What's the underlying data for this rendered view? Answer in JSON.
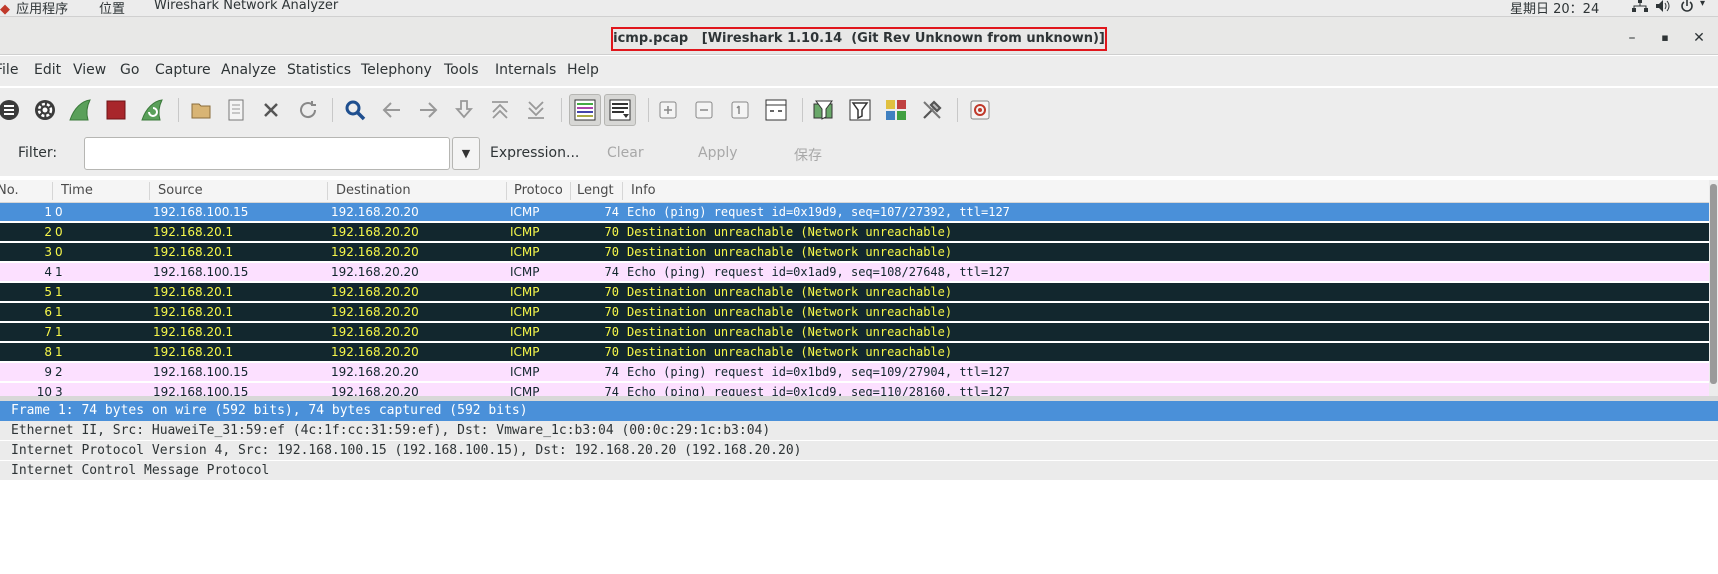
{
  "system_bar": {
    "apps_label": "应用程序",
    "places_label": "位置",
    "app_label": "Wireshark Network Analyzer",
    "clock": "星期日 20：24"
  },
  "window": {
    "title": "icmp.pcap   [Wireshark 1.10.14  (Git Rev Unknown from unknown)]"
  },
  "menu": [
    "File",
    "Edit",
    "View",
    "Go",
    "Capture",
    "Analyze",
    "Statistics",
    "Telephony",
    "Tools",
    "Internals",
    "Help"
  ],
  "toolbar_icons": [
    "interfaces-icon",
    "options-icon",
    "start-capture-icon",
    "stop-capture-icon",
    "restart-capture-icon",
    "open-file-icon",
    "save-file-icon",
    "close-file-icon",
    "reload-icon",
    "find-packet-icon",
    "go-back-icon",
    "go-forward-icon",
    "go-to-packet-icon",
    "go-first-icon",
    "go-last-icon",
    "colorize-icon",
    "auto-scroll-icon",
    "zoom-in-icon",
    "zoom-out-icon",
    "normal-size-icon",
    "resize-columns-icon",
    "capture-filters-icon",
    "display-filters-icon",
    "coloring-rules-icon",
    "preferences-icon",
    "help-icon"
  ],
  "filter": {
    "label": "Filter:",
    "value": "",
    "expression": "Expression...",
    "clear": "Clear",
    "apply": "Apply",
    "save": "保存"
  },
  "packet_list": {
    "columns": [
      "No.",
      "Time",
      "Source",
      "Destination",
      "Protocol",
      "Length",
      "Info"
    ],
    "column_display": [
      "No.",
      "Time",
      "Source",
      "Destination",
      "Protoco",
      "Lengt",
      "Info"
    ],
    "rows": [
      {
        "no": "1",
        "time": "0",
        "src": "192.168.100.15",
        "dst": "192.168.20.20",
        "proto": "ICMP",
        "len": "74",
        "info": "Echo (ping) request  id=0x19d9, seq=107/27392, ttl=127",
        "style": "sel"
      },
      {
        "no": "2",
        "time": "0",
        "src": "192.168.20.1",
        "dst": "192.168.20.20",
        "proto": "ICMP",
        "len": "70",
        "info": "Destination unreachable (Network unreachable)",
        "style": "dark"
      },
      {
        "no": "3",
        "time": "0",
        "src": "192.168.20.1",
        "dst": "192.168.20.20",
        "proto": "ICMP",
        "len": "70",
        "info": "Destination unreachable (Network unreachable)",
        "style": "dark"
      },
      {
        "no": "4",
        "time": "1",
        "src": "192.168.100.15",
        "dst": "192.168.20.20",
        "proto": "ICMP",
        "len": "74",
        "info": "Echo (ping) request  id=0x1ad9, seq=108/27648, ttl=127",
        "style": "pink"
      },
      {
        "no": "5",
        "time": "1",
        "src": "192.168.20.1",
        "dst": "192.168.20.20",
        "proto": "ICMP",
        "len": "70",
        "info": "Destination unreachable (Network unreachable)",
        "style": "dark"
      },
      {
        "no": "6",
        "time": "1",
        "src": "192.168.20.1",
        "dst": "192.168.20.20",
        "proto": "ICMP",
        "len": "70",
        "info": "Destination unreachable (Network unreachable)",
        "style": "dark"
      },
      {
        "no": "7",
        "time": "1",
        "src": "192.168.20.1",
        "dst": "192.168.20.20",
        "proto": "ICMP",
        "len": "70",
        "info": "Destination unreachable (Network unreachable)",
        "style": "dark"
      },
      {
        "no": "8",
        "time": "1",
        "src": "192.168.20.1",
        "dst": "192.168.20.20",
        "proto": "ICMP",
        "len": "70",
        "info": "Destination unreachable (Network unreachable)",
        "style": "dark"
      },
      {
        "no": "9",
        "time": "2",
        "src": "192.168.100.15",
        "dst": "192.168.20.20",
        "proto": "ICMP",
        "len": "74",
        "info": "Echo (ping) request  id=0x1bd9, seq=109/27904, ttl=127",
        "style": "pink"
      },
      {
        "no": "10",
        "time": "3",
        "src": "192.168.100.15",
        "dst": "192.168.20.20",
        "proto": "ICMP",
        "len": "74",
        "info": "Echo (ping) request  id=0x1cd9, seq=110/28160, ttl=127",
        "style": "pink"
      }
    ]
  },
  "details": [
    {
      "text": "Frame 1: 74 bytes on wire (592 bits), 74 bytes captured (592 bits)",
      "style": "sel"
    },
    {
      "text": "Ethernet II, Src: HuaweiTe_31:59:ef (4c:1f:cc:31:59:ef), Dst: Vmware_1c:b3:04 (00:0c:29:1c:b3:04)",
      "style": "grey"
    },
    {
      "text": "Internet Protocol Version 4, Src: 192.168.100.15 (192.168.100.15), Dst: 192.168.20.20 (192.168.20.20)",
      "style": "grey"
    },
    {
      "text": "Internet Control Message Protocol",
      "style": "grey"
    }
  ],
  "colors": {
    "selected_row": "#4a90d9",
    "icmp_error_bg": "#12272e",
    "icmp_error_fg": "#f7f74b",
    "icmp_bg": "#fce0ff",
    "title_highlight_border": "#e0161c"
  }
}
